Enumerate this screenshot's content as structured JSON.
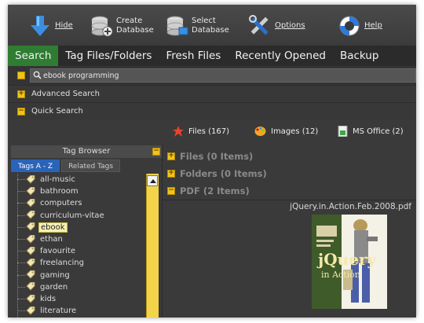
{
  "toolbar": {
    "hide": "Hide",
    "create_db": [
      "Create",
      "Database"
    ],
    "select_db": [
      "Select",
      "Database"
    ],
    "options": "Options",
    "help": "Help"
  },
  "tabs": [
    "Search",
    "Tag Files/Folders",
    "Fresh Files",
    "Recently Opened",
    "Backup"
  ],
  "active_tab": "Search",
  "search": {
    "value": "ebook programming"
  },
  "sections": {
    "advanced": "Advanced Search",
    "quick": "Quick Search"
  },
  "filters": [
    {
      "label": "Files (167)",
      "icon": "star-icon"
    },
    {
      "label": "Images (12)",
      "icon": "palette-icon"
    },
    {
      "label": "MS Office (2)",
      "icon": "office-icon"
    }
  ],
  "tag_browser": {
    "title": "Tag Browser",
    "subtabs": [
      "Tags A - Z",
      "Related Tags"
    ],
    "tags": [
      "all-music",
      "bathroom",
      "computers",
      "curriculum-vitae",
      "ebook",
      "ethan",
      "favourite",
      "freelancing",
      "gaming",
      "garden",
      "kids",
      "literature"
    ],
    "selected": "ebook"
  },
  "results": {
    "groups": [
      "Files (0 Items)",
      "Folders (0 Items)",
      "PDF (2 Items)"
    ],
    "file_name": "jQuery.in.Action.Feb.2008.pdf",
    "cover": {
      "title": "jQuery",
      "subtitle": "in Action"
    }
  },
  "colors": {
    "accent_green": "#2e7d32",
    "highlight_yellow": "#f0c419",
    "selected_tag_bg": "#f7f1b4"
  }
}
